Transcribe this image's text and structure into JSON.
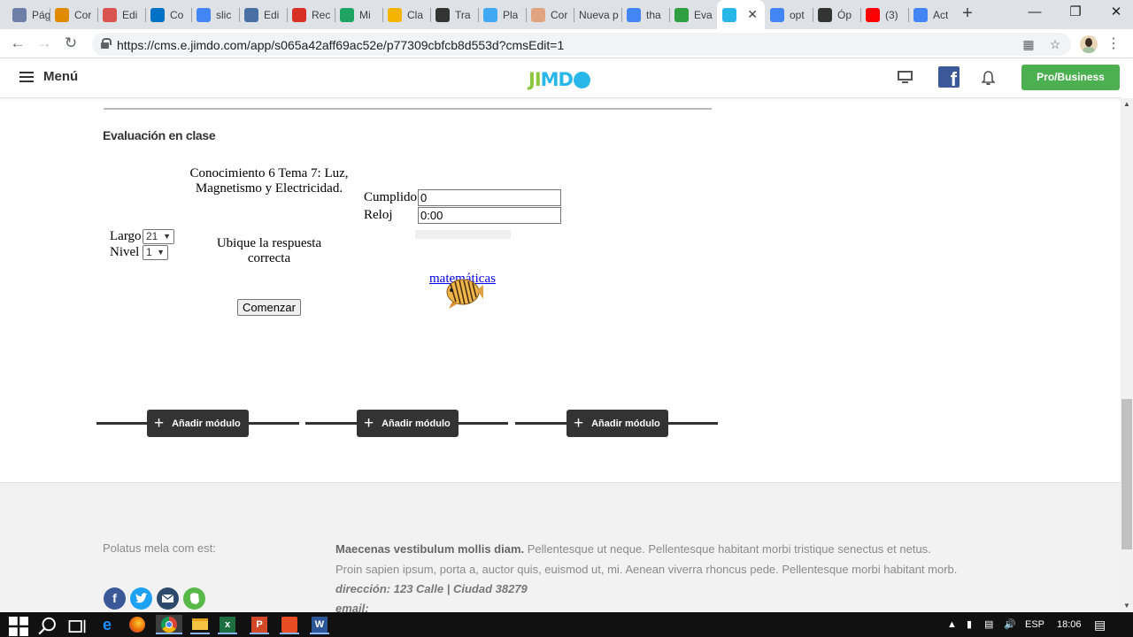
{
  "browser": {
    "tabs": [
      {
        "title": "Pág",
        "icon": "network-icon",
        "color": "#6d7fa6"
      },
      {
        "title": "Cor",
        "icon": "m-logo-icon",
        "color": "#e08a00"
      },
      {
        "title": "Edi",
        "icon": "s-logo-icon",
        "color": "#d9534f"
      },
      {
        "title": "Co",
        "icon": "outlook-icon",
        "color": "#0072c6"
      },
      {
        "title": "slic",
        "icon": "google-icon",
        "color": "#4285f4"
      },
      {
        "title": "Edi",
        "icon": "edit-icon",
        "color": "#4a6fa5"
      },
      {
        "title": "Rec",
        "icon": "gmail-icon",
        "color": "#d93025"
      },
      {
        "title": "Mi",
        "icon": "drive-icon",
        "color": "#1fa463"
      },
      {
        "title": "Cla",
        "icon": "classroom-icon",
        "color": "#f4b400"
      },
      {
        "title": "Tra",
        "icon": "portrait-icon",
        "color": "#333333"
      },
      {
        "title": "Pla",
        "icon": "k-logo-icon",
        "color": "#3fa9f5"
      },
      {
        "title": "Cor",
        "icon": "brain-icon",
        "color": "#e0a480"
      },
      {
        "title": "Nueva p",
        "icon": "",
        "color": ""
      },
      {
        "title": "tha",
        "icon": "google-icon",
        "color": "#4285f4"
      },
      {
        "title": "Eva",
        "icon": "px-icon",
        "color": "#2e9e41"
      },
      {
        "title": "",
        "icon": "jimdo-icon",
        "color": "#29b6e8"
      },
      {
        "title": "opt",
        "icon": "google-icon",
        "color": "#4285f4"
      },
      {
        "title": "Óp",
        "icon": "wikipedia-icon",
        "color": "#333333"
      },
      {
        "title": "(3)",
        "icon": "youtube-icon",
        "color": "#ff0000"
      },
      {
        "title": "Act",
        "icon": "docs-icon",
        "color": "#4285f4"
      }
    ],
    "url": "https://cms.e.jimdo.com/app/s065a42aff69ac52e/p77309cbfcb8d553d?cmsEdit=1"
  },
  "jimdo": {
    "menu_label": "Menú",
    "logo_text": "JIMDO",
    "pro_button": "Pro/Business",
    "facebook_letter": "f"
  },
  "content": {
    "section_title": "Evaluación en clase",
    "quiz_title": "Conocimiento 6 Tema 7: Luz, Magnetismo y Electricidad.",
    "cumplido_label": "Cumplido",
    "cumplido_value": "0",
    "reloj_label": "Reloj",
    "reloj_value": "0:00",
    "largo_label": "Largo",
    "largo_value": "21",
    "nivel_label": "Nivel",
    "nivel_value": "1",
    "instruction": "Ubique la respuesta correcta",
    "link_text": "matemáticas",
    "start_button": "Comenzar",
    "add_module_label": "Añadir módulo"
  },
  "footer": {
    "left_text": "Polatus mela com est:",
    "bold_lead": "Maecenas vestibulum mollis diam.",
    "line1": "Pellentesque ut neque. Pellentesque habitant morbi tristique senectus et netus.",
    "line2": "Proin sapien ipsum, porta a, auctor quis, euismod ut, mi. Aenean viverra rhoncus pede. Pellentesque morbi habitant morb.",
    "address": "dirección: 123 Calle | Ciudad 38279",
    "email_label": "email:"
  },
  "taskbar": {
    "language": "ESP",
    "time": "18:06"
  }
}
